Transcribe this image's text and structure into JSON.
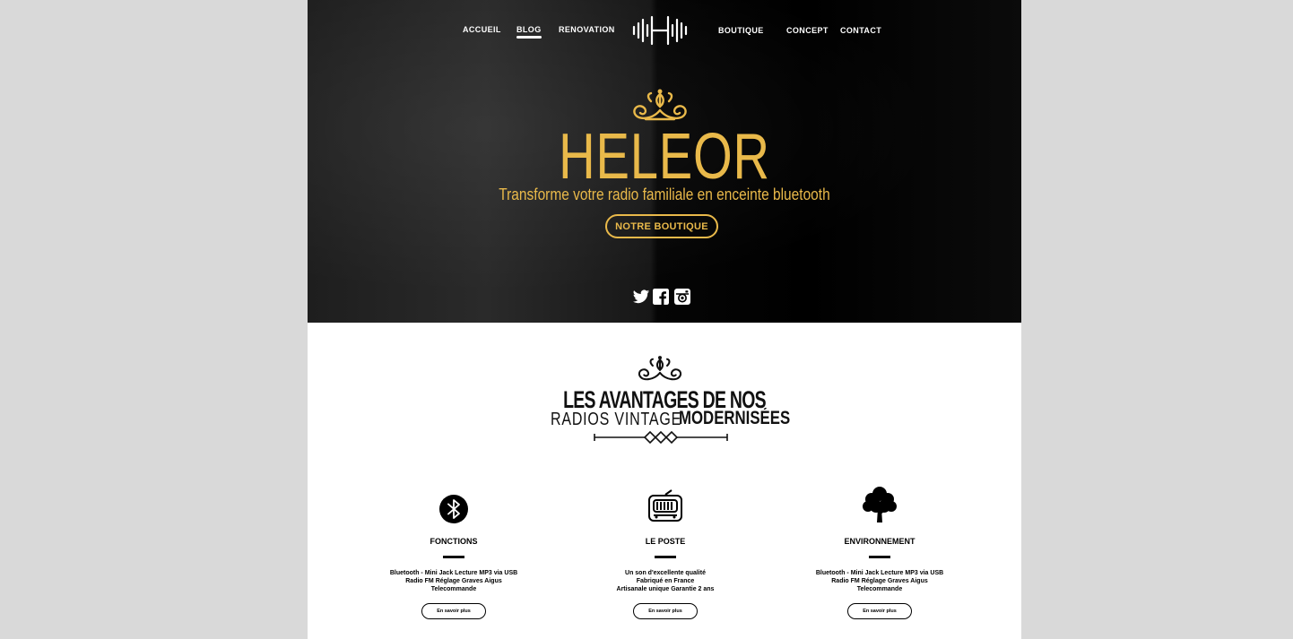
{
  "nav": {
    "items": [
      {
        "label": "ACCUEIL"
      },
      {
        "label": "BLOG"
      },
      {
        "label": "RENOVATION"
      },
      {
        "label": "BOUTIQUE"
      },
      {
        "label": "CONCEPT"
      },
      {
        "label": "CONTACT"
      }
    ],
    "active": "BLOG"
  },
  "hero": {
    "brand": "HELEOR",
    "tagline": "Transforme votre radio familiale en enceinte bluetooth",
    "cta_label": "NOTRE BOUTIQUE",
    "social_icons": [
      "twitter-icon",
      "facebook-icon",
      "instagram-icon"
    ]
  },
  "section": {
    "title_line1": "LES AVANTAGES DE NOS",
    "title_line2_part1": "RADIOS VINTAGE",
    "title_line2_part2": "MODERNISÉES"
  },
  "features": [
    {
      "icon": "bluetooth-icon",
      "title": "FONCTIONS",
      "lines": [
        "Bluetooth - Mini Jack Lecture MP3 via USB",
        "Radio FM Réglage Graves Aigus",
        "Telecommande"
      ],
      "button": "En savoir plus"
    },
    {
      "icon": "radio-icon",
      "title": "LE POSTE",
      "lines": [
        "Un son d'excellente qualité",
        "Fabriqué en France",
        "Artisanale unique Garantie 2 ans"
      ],
      "button": "En savoir plus"
    },
    {
      "icon": "tree-icon",
      "title": "ENVIRONNEMENT",
      "lines": [
        "Bluetooth - Mini Jack Lecture MP3 via USB",
        "Radio FM Réglage Graves Aigus",
        "Telecommande"
      ],
      "button": "En savoir plus"
    }
  ],
  "colors": {
    "gold": "#e9b94a",
    "background": "#d9d9d9",
    "hero_dark": "#1e1e1e"
  }
}
